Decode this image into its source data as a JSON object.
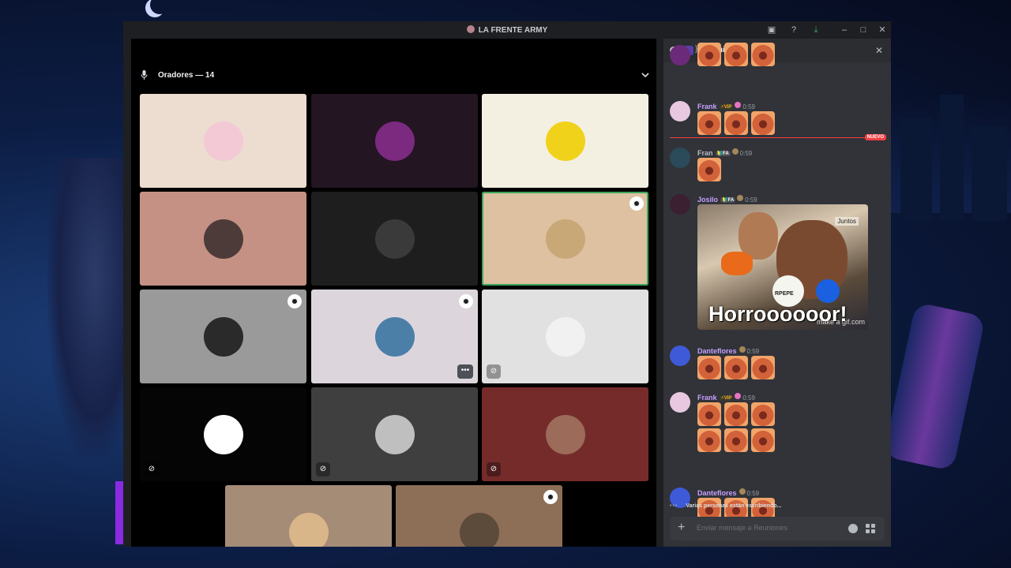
{
  "window": {
    "title": "LA FRENTE ARMY"
  },
  "stage": {
    "section_title": "Oradores — 14",
    "tiles": [
      {
        "bg": "#eddcd0",
        "av": "#f3c9d6",
        "badge": false,
        "mute": false,
        "more": false
      },
      {
        "bg": "#241522",
        "av": "#7b2a7f",
        "badge": false,
        "mute": false,
        "more": false
      },
      {
        "bg": "#f3f0e2",
        "av": "#f1d21a",
        "badge": false,
        "mute": false,
        "more": false
      },
      {
        "bg": "#c49184",
        "av": "#4d3b3a",
        "badge": false,
        "mute": false,
        "more": false
      },
      {
        "bg": "#1d1e1d",
        "av": "#3a3a3a",
        "badge": false,
        "mute": false,
        "more": false
      },
      {
        "bg": "#ddc1a0",
        "av": "#c9a877",
        "badge": true,
        "mute": false,
        "more": false,
        "active": true
      },
      {
        "bg": "#9a9a9a",
        "av": "#2a2a2a",
        "badge": true,
        "mute": false,
        "more": false
      },
      {
        "bg": "#dcd6dc",
        "av": "#4b7fa8",
        "badge": true,
        "mute": false,
        "more": true
      },
      {
        "bg": "#e1e1e1",
        "av": "#f1f1f1",
        "badge": false,
        "mute": true,
        "more": false
      },
      {
        "bg": "#050505",
        "av": "#ffffff",
        "badge": false,
        "mute": true,
        "more": false
      },
      {
        "bg": "#3f3f3f",
        "av": "#bfbfbf",
        "badge": false,
        "mute": true,
        "more": false
      },
      {
        "bg": "#762b2b",
        "av": "#9c6b5a",
        "badge": false,
        "mute": true,
        "more": false
      },
      {
        "bg": "#a58c76",
        "av": "#d9b58a",
        "badge": false,
        "mute": false,
        "more": false
      },
      {
        "bg": "#8d6e57",
        "av": "#5c4a3b",
        "badge": true,
        "mute": false,
        "more": false
      }
    ]
  },
  "chat": {
    "channel_name": "Reuniones",
    "new_label": "NUEVO",
    "messages": [
      {
        "user": "",
        "color": "#c7a0ff",
        "tags": [],
        "time": "",
        "avatar": "#6b2a7a",
        "stickers": 3,
        "rows": 1
      },
      {
        "user": "Frank",
        "color": "#c7a0ff",
        "tags": [
          {
            "t": "⚡VIP",
            "c": "vip"
          },
          {
            "t": "",
            "c": "star"
          }
        ],
        "time": "0:59",
        "avatar": "#e8c8e0",
        "stickers": 3,
        "rows": 1
      },
      {
        "user": "Fran",
        "color": "#b5bac1",
        "tags": [
          {
            "t": "🔰FA",
            "c": "fa"
          },
          {
            "t": "",
            "c": "medal"
          }
        ],
        "time": "0:59",
        "avatar": "#2b4a5a",
        "stickers": 1,
        "rows": 1
      },
      {
        "user": "Josilo",
        "color": "#c7a0ff",
        "tags": [
          {
            "t": "🔰FA",
            "c": "fa"
          },
          {
            "t": "",
            "c": "medal"
          }
        ],
        "time": "0:59",
        "avatar": "#3a2030",
        "gif": true
      },
      {
        "user": "Danteflores",
        "color": "#c7a0ff",
        "tags": [
          {
            "t": "",
            "c": "medal"
          }
        ],
        "time": "0:59",
        "avatar": "#3f5ad8",
        "stickers": 3,
        "rows": 1
      },
      {
        "user": "Frank",
        "color": "#c7a0ff",
        "tags": [
          {
            "t": "⚡VIP",
            "c": "vip"
          },
          {
            "t": "",
            "c": "star"
          }
        ],
        "time": "0:59",
        "avatar": "#e8c8e0",
        "stickers": 3,
        "rows": 2
      },
      {
        "user": "Danteflores",
        "color": "#c7a0ff",
        "tags": [
          {
            "t": "",
            "c": "medal"
          }
        ],
        "time": "0:59",
        "avatar": "#3f5ad8",
        "stickers": 3,
        "rows": 1
      }
    ],
    "gif_caption": "Horroooooor!",
    "gif_watermark": "make a gif.com",
    "gif_sign": "Juntos",
    "gif_mic_label": "RPEPE",
    "typing": "Varias personas están escribiendo...",
    "composer_placeholder": "Enviar mensaje a  Reuniones"
  },
  "colors": {
    "bg": "#0c1d44",
    "window": "#1e1f22",
    "chat": "#313338",
    "accent_green": "#3ba55d",
    "unread_red": "#f23f43"
  }
}
